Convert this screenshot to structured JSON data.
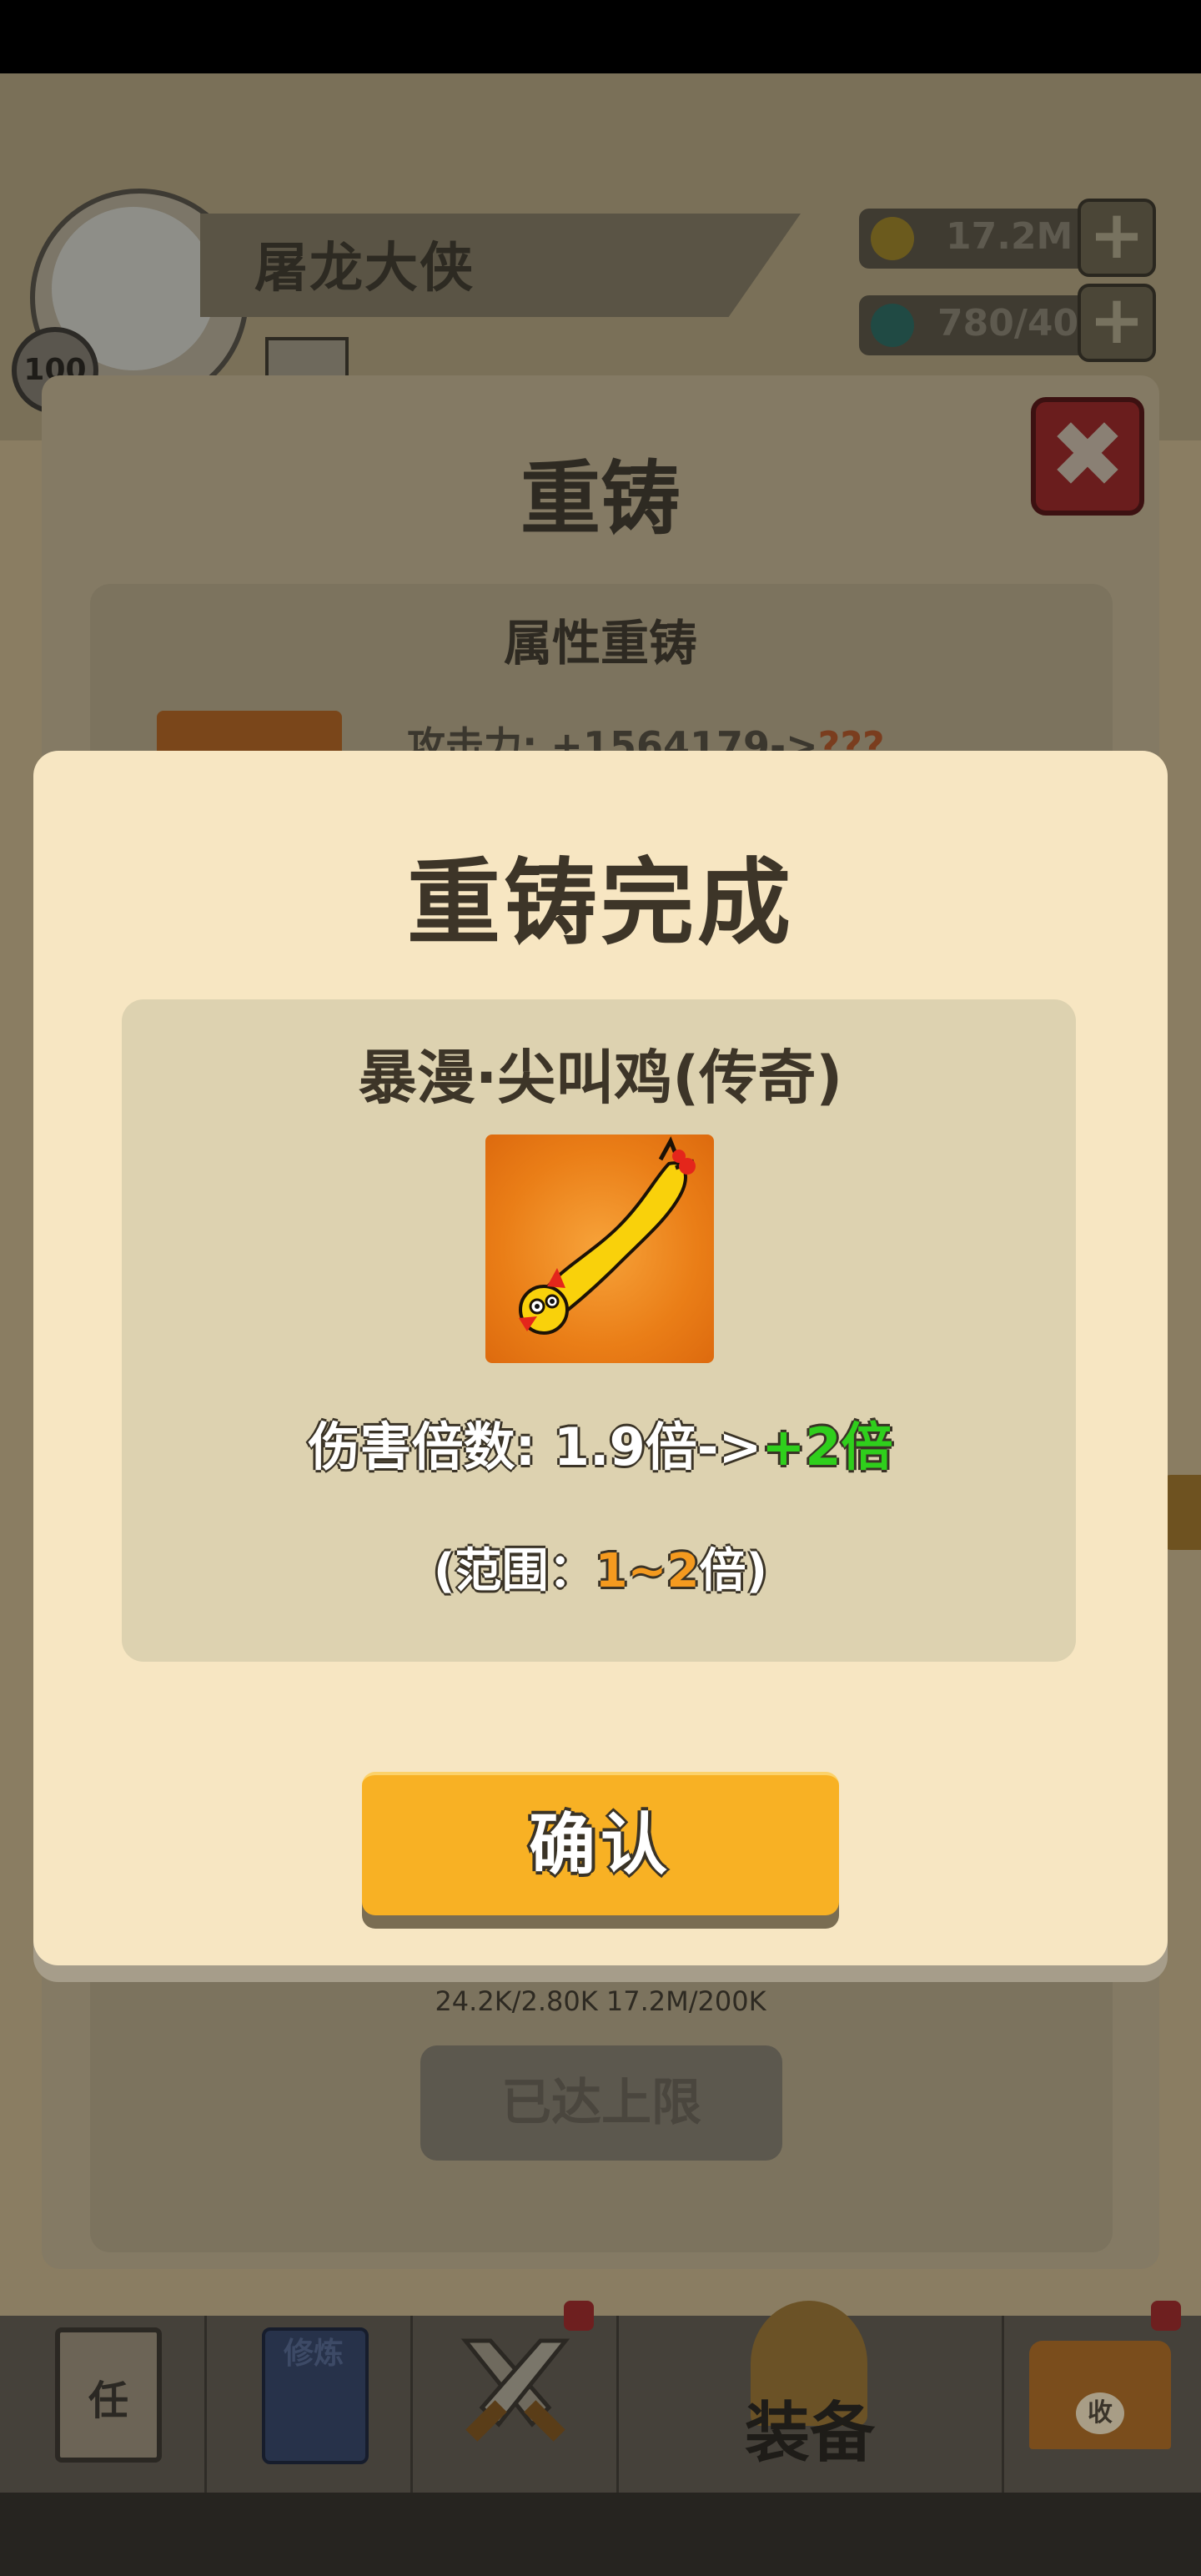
{
  "header": {
    "player_name": "屠龙大侠",
    "level": "100",
    "gold": "17.2M",
    "gems": "780/40"
  },
  "reforge_panel": {
    "title": "重铸",
    "section_title": "属性重铸",
    "attr_line": "攻击力: +1564179->",
    "attr_unknown": "???",
    "stats": "24.2K/2.80K  17.2M/200K",
    "limit_button": "已达上限"
  },
  "bottom_nav": {
    "task": "任",
    "train": "修炼",
    "equip": "装备",
    "collect": "收"
  },
  "modal": {
    "title": "重铸完成",
    "item_name": "暴漫·尖叫鸡(传奇)",
    "damage_prefix": "伤害倍数: 1.9倍->",
    "damage_new": "+2倍",
    "range_open": "(范围：",
    "range_min": "1",
    "range_sep": "~",
    "range_max": "2",
    "range_close": "倍)",
    "confirm": "确认"
  },
  "colors": {
    "modal_bg": "#f7e6c2",
    "info_box": "#ddd2b0",
    "confirm_button": "#f8b124",
    "new_value": "#2fcf1c",
    "range_value": "#f49a1f"
  },
  "icons": {
    "item": "rubber-chicken-icon",
    "gold": "gold-coin-icon",
    "gem": "gem-icon",
    "close": "close-icon",
    "weapon": "crossed-swords-icon"
  }
}
